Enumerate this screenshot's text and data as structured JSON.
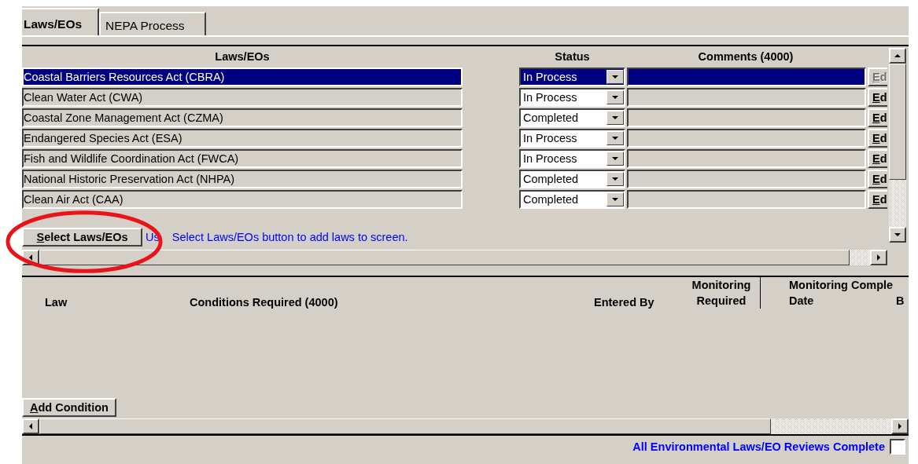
{
  "tabs": [
    {
      "label": "Laws/EOs",
      "selected": true
    },
    {
      "label": "NEPA Process",
      "selected": false
    }
  ],
  "laws_table": {
    "columns": [
      "Laws/EOs",
      "Status",
      "Comments (4000)"
    ],
    "rows": [
      {
        "law": "Coastal Barriers Resources Act (CBRA)",
        "status": "In Process",
        "edit": "Ed",
        "selected": true
      },
      {
        "law": "Clean Water Act (CWA)",
        "status": "In Process",
        "edit": "Ed",
        "selected": false
      },
      {
        "law": "Coastal Zone Management Act (CZMA)",
        "status": "Completed",
        "edit": "Ed",
        "selected": false
      },
      {
        "law": "Endangered Species Act (ESA)",
        "status": "In Process",
        "edit": "Ed",
        "selected": false
      },
      {
        "law": "Fish and Wildlife Coordination Act (FWCA)",
        "status": "In Process",
        "edit": "Ed",
        "selected": false
      },
      {
        "law": "National Historic Preservation Act (NHPA)",
        "status": "Completed",
        "edit": "Ed",
        "selected": false
      },
      {
        "law": "Clean Air Act (CAA)",
        "status": "Completed",
        "edit": "Ed",
        "selected": false
      }
    ]
  },
  "select_button": "Select Laws/EOs",
  "hint": [
    "Us",
    "Select Laws/EOs button to add laws to screen."
  ],
  "conditions_table": {
    "columns": [
      "Law",
      "Conditions Required (4000)",
      "Entered By",
      "Monitoring Required"
    ],
    "group": {
      "label": "Monitoring Comple",
      "columns": [
        "Date",
        "B"
      ]
    }
  },
  "add_button": "Add Condition",
  "footer": {
    "label": "All Environmental Laws/EO Reviews Complete",
    "checked": false
  }
}
